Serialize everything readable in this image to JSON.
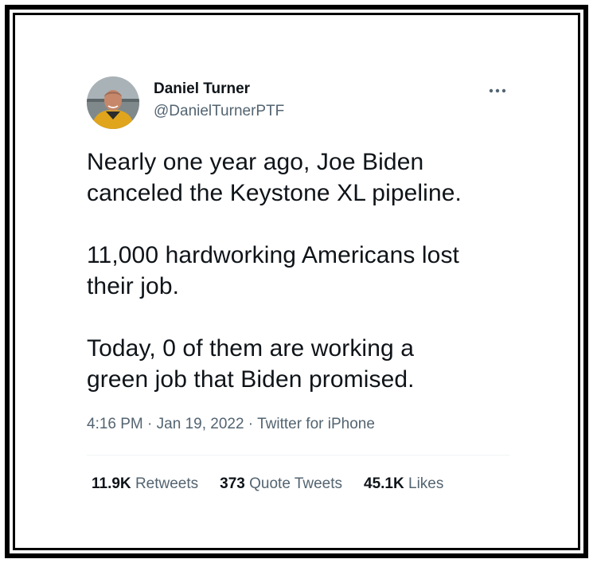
{
  "author": {
    "display_name": "Daniel Turner",
    "handle": "@DanielTurnerPTF"
  },
  "tweet": {
    "paragraphs": [
      "Nearly one year ago, Joe Biden\ncanceled the Keystone XL pipeline.",
      "11,000 hardworking Americans lost\ntheir job.",
      "Today, 0 of them are working a\ngreen job that Biden promised."
    ]
  },
  "meta": {
    "time": "4:16 PM",
    "separator": " · ",
    "date": "Jan 19, 2022",
    "source": "Twitter for iPhone"
  },
  "stats": {
    "retweets_count": "11.9K",
    "retweets_label": "Retweets",
    "quotes_count": "373",
    "quotes_label": "Quote Tweets",
    "likes_count": "45.1K",
    "likes_label": "Likes"
  },
  "icons": {
    "more": "more-horizontal-icon"
  },
  "colors": {
    "text_primary": "#0f1419",
    "text_secondary": "#536471",
    "border": "#000000",
    "divider": "#eff3f4"
  }
}
